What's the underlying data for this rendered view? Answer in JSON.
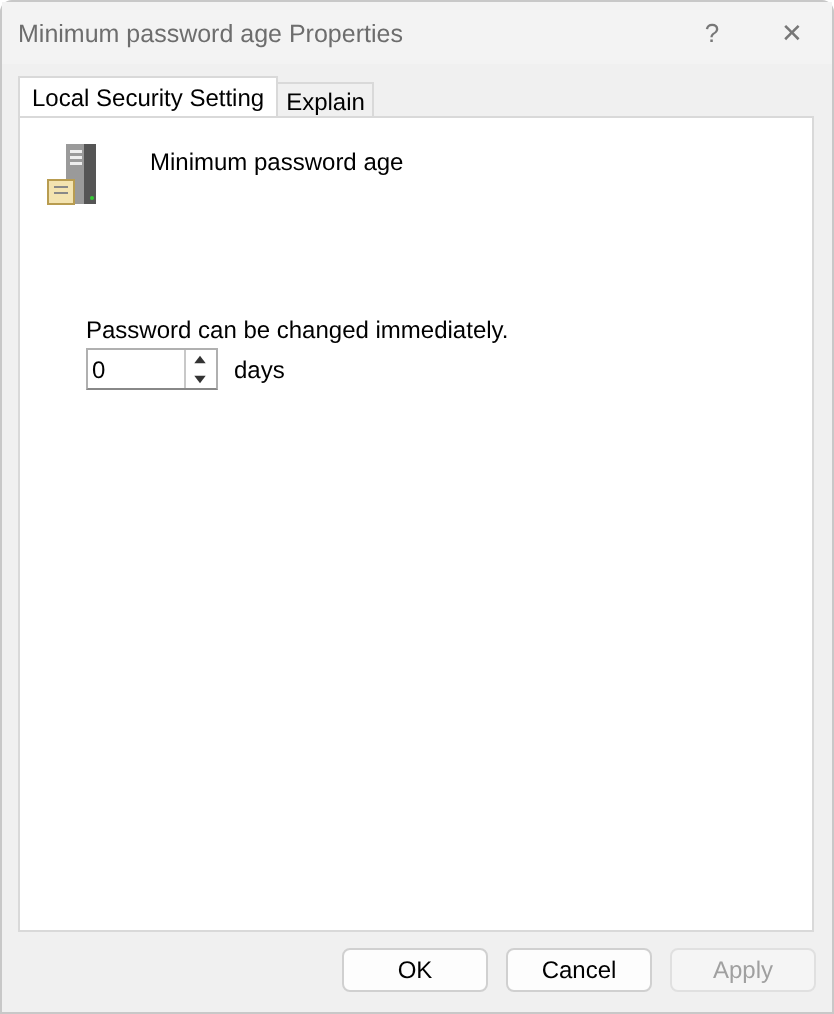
{
  "window": {
    "title": "Minimum password age Properties",
    "help": "?",
    "close": "✕"
  },
  "tabs": [
    {
      "label": "Local Security Setting",
      "selected": true
    },
    {
      "label": "Explain",
      "selected": false
    }
  ],
  "policy_name": "Minimum password age",
  "description": "Password can be changed immediately.",
  "spinner": {
    "value": "0",
    "unit": "days"
  },
  "buttons": [
    {
      "label": "OK",
      "disabled": false
    },
    {
      "label": "Cancel",
      "disabled": false
    },
    {
      "label": "Apply",
      "disabled": true
    }
  ]
}
